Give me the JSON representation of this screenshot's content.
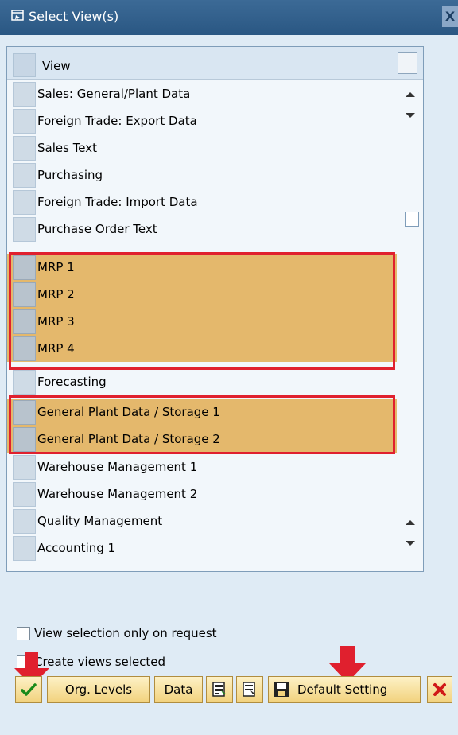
{
  "window": {
    "title": "Select View(s)",
    "close_glyph": "X",
    "title_icon": "window-icon"
  },
  "grid": {
    "header": "View",
    "rows": [
      {
        "label": "Sales: General/Plant Data",
        "highlighted": false
      },
      {
        "label": "Foreign Trade: Export Data",
        "highlighted": false
      },
      {
        "label": "Sales Text",
        "highlighted": false
      },
      {
        "label": "Purchasing",
        "highlighted": false
      },
      {
        "label": "Foreign Trade: Import Data",
        "highlighted": false
      },
      {
        "label": "Purchase Order Text",
        "highlighted": false
      },
      {
        "label": "MRP 1",
        "highlighted": true
      },
      {
        "label": "MRP 2",
        "highlighted": true
      },
      {
        "label": "MRP 3",
        "highlighted": true
      },
      {
        "label": "MRP 4",
        "highlighted": true
      },
      {
        "label": "Forecasting",
        "highlighted": false
      },
      {
        "label": "General Plant Data / Storage 1",
        "highlighted": true
      },
      {
        "label": "General Plant Data / Storage 2",
        "highlighted": true
      },
      {
        "label": "Warehouse Management 1",
        "highlighted": false
      },
      {
        "label": "Warehouse Management 2",
        "highlighted": false
      },
      {
        "label": "Quality Management",
        "highlighted": false
      },
      {
        "label": "Accounting 1",
        "highlighted": false
      }
    ]
  },
  "options": {
    "view_selection_label": "View selection only on request",
    "create_views_label": "Create views selected",
    "view_selection_checked": false,
    "create_views_checked": false
  },
  "toolbar": {
    "continue_icon": "checkmark-icon",
    "org_levels_label": "Org. Levels",
    "data_label": "Data",
    "select_all_icon": "select-all-icon",
    "deselect_all_icon": "deselect-all-icon",
    "save_icon": "save-icon",
    "default_setting_label": "Default Setting",
    "cancel_icon": "cancel-icon"
  },
  "colors": {
    "highlight": "#e4b86c",
    "annotation": "#e0202e",
    "titlebar": "#2a5783"
  }
}
